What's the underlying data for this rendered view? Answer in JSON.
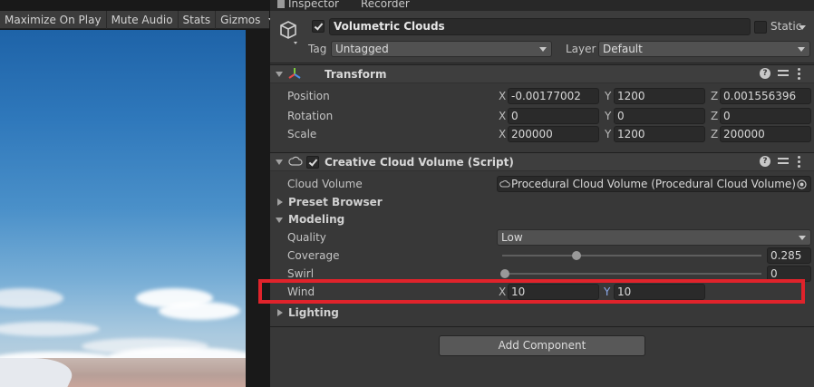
{
  "game_view": {
    "toolbar": {
      "maximize_label": "Maximize On Play",
      "mute_label": "Mute Audio",
      "stats_label": "Stats",
      "gizmos_label": "Gizmos"
    }
  },
  "tabs": {
    "inspector": "Inspector",
    "recorder": "Recorder"
  },
  "header": {
    "name": "Volumetric Clouds",
    "static_label": "Static",
    "tag_label": "Tag",
    "tag_value": "Untagged",
    "layer_label": "Layer",
    "layer_value": "Default"
  },
  "transform": {
    "title": "Transform",
    "position": {
      "label": "Position",
      "x": "-0.00177002",
      "y": "1200",
      "z": "0.001556396"
    },
    "rotation": {
      "label": "Rotation",
      "x": "0",
      "y": "0",
      "z": "0"
    },
    "scale": {
      "label": "Scale",
      "x": "200000",
      "y": "1200",
      "z": "200000"
    },
    "axis": {
      "x": "X",
      "y": "Y",
      "z": "Z"
    }
  },
  "cloud_component": {
    "title": "Creative Cloud Volume (Script)",
    "cloud_volume_label": "Cloud Volume",
    "cloud_volume_value": "Procedural Cloud Volume (Procedural Cloud Volume)",
    "preset_browser": "Preset Browser",
    "modeling": "Modeling",
    "quality_label": "Quality",
    "quality_value": "Low",
    "coverage_label": "Coverage",
    "coverage_value": "0.285",
    "coverage_fraction": 0.285,
    "swirl_label": "Swirl",
    "swirl_value": "0",
    "swirl_fraction": 0,
    "wind_label": "Wind",
    "wind_x": "10",
    "wind_y": "10",
    "lighting": "Lighting"
  },
  "add_component_label": "Add Component",
  "colors": {
    "highlight": "#e0232b",
    "panel": "#383838"
  }
}
